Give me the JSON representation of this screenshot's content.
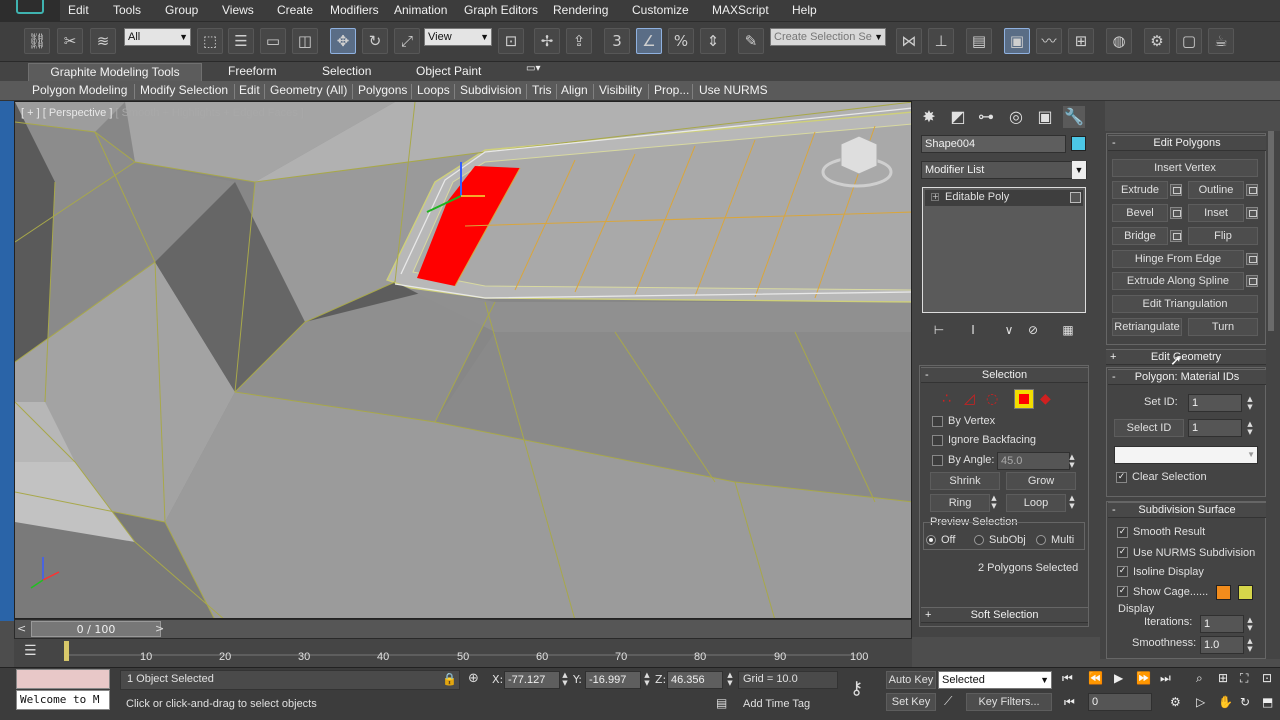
{
  "menu": [
    "Edit",
    "Tools",
    "Group",
    "Views",
    "Create",
    "Modifiers",
    "Animation",
    "Graph Editors",
    "Rendering",
    "Customize",
    "MAXScript",
    "Help"
  ],
  "toolbar": {
    "selection_filter": "All",
    "ref_coord": "View",
    "named_selection": "Create Selection Se"
  },
  "ribbon": {
    "tabs": [
      "Graphite Modeling Tools",
      "Freeform",
      "Selection",
      "Object Paint"
    ],
    "subtabs": [
      "Polygon Modeling",
      "Modify Selection",
      "Edit",
      "Geometry (All)",
      "Polygons",
      "Loops",
      "Subdivision",
      "Tris",
      "Align",
      "Visibility",
      "Prop...",
      "Use NURMS"
    ]
  },
  "viewport": {
    "label_plus": "[ + ]",
    "label_view": "[ Perspective ]",
    "label_shading": "[ Smooth + Highlights + Edged Faces ]"
  },
  "modify_panel": {
    "object_name": "Shape004",
    "object_color": "#4cc7e6",
    "modifier_list": "Modifier List",
    "stack_item": "Editable Poly"
  },
  "selection": {
    "title": "Selection",
    "by_vertex": "By Vertex",
    "ignore_backfacing": "Ignore Backfacing",
    "by_angle": "By Angle:",
    "angle_value": "45.0",
    "shrink": "Shrink",
    "grow": "Grow",
    "ring": "Ring",
    "loop": "Loop",
    "preview_title": "Preview Selection",
    "preview_off": "Off",
    "preview_subobj": "SubObj",
    "preview_multi": "Multi",
    "status": "2 Polygons Selected",
    "soft_selection": "Soft Selection"
  },
  "edit_polygons": {
    "title": "Edit Polygons",
    "insert_vertex": "Insert Vertex",
    "extrude": "Extrude",
    "outline": "Outline",
    "bevel": "Bevel",
    "inset": "Inset",
    "bridge": "Bridge",
    "flip": "Flip",
    "hinge": "Hinge From Edge",
    "extrude_spline": "Extrude Along Spline",
    "edit_tri": "Edit Triangulation",
    "retriangulate": "Retriangulate",
    "turn": "Turn"
  },
  "edit_geometry": {
    "title": "Edit Geometry"
  },
  "material_ids": {
    "title": "Polygon: Material IDs",
    "set_id": "Set ID:",
    "set_id_value": "1",
    "select_id": "Select ID",
    "select_id_value": "1",
    "clear_selection": "Clear Selection"
  },
  "subdivision": {
    "title": "Subdivision Surface",
    "smooth_result": "Smooth Result",
    "use_nurms": "Use NURMS Subdivision",
    "isoline": "Isoline Display",
    "show_cage": "Show Cage......",
    "cage_color_1": "#f28c1c",
    "cage_color_2": "#d6d64a",
    "display": "Display",
    "iterations": "Iterations:",
    "iterations_value": "1",
    "smoothness": "Smoothness:",
    "smoothness_value": "1.0"
  },
  "timeline": {
    "frame": "0 / 100",
    "ticks": [
      "10",
      "20",
      "30",
      "40",
      "50",
      "60",
      "70",
      "80",
      "90",
      "100"
    ]
  },
  "status": {
    "maxscript": "Welcome to M",
    "objects": "1 Object Selected",
    "prompt": "Click or click-and-drag to select objects",
    "x_label": "X:",
    "x_value": "-77.127",
    "y_label": "Y:",
    "y_value": "-16.997",
    "z_label": "Z:",
    "z_value": "46.356",
    "grid": "Grid = 10.0",
    "add_time_tag": "Add Time Tag",
    "auto_key": "Auto Key",
    "set_key": "Set Key",
    "key_mode": "Selected",
    "key_filters": "Key Filters...",
    "current_frame": "0"
  }
}
